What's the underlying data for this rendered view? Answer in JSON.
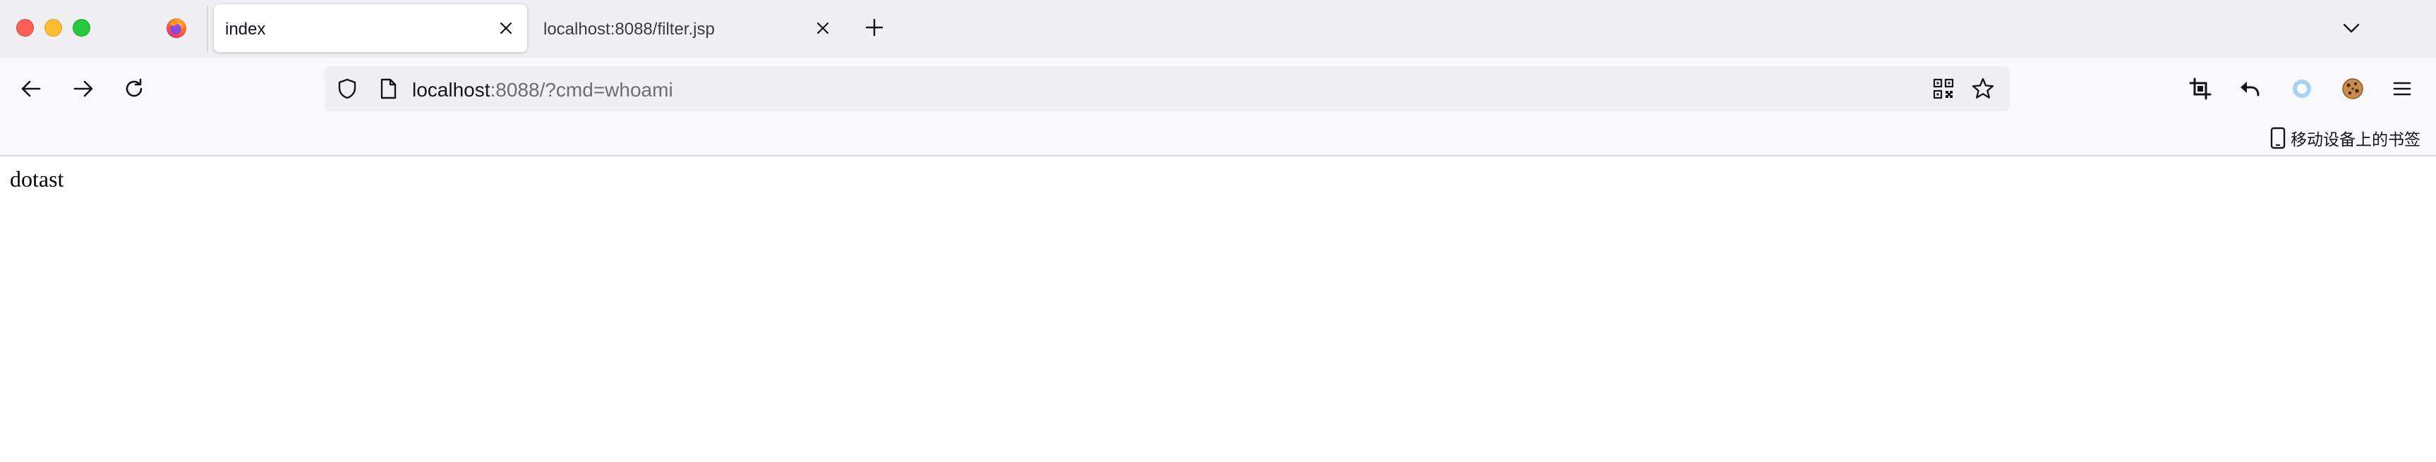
{
  "window": {
    "tabs": [
      {
        "label": "index",
        "active": true
      },
      {
        "label": "localhost:8088/filter.jsp",
        "active": false
      }
    ]
  },
  "urlbar": {
    "host": "localhost",
    "rest": ":8088/?cmd=whoami"
  },
  "bookmarks_bar": {
    "mobile_bookmarks_label": "移动设备上的书签"
  },
  "page": {
    "body_text": "dotast"
  },
  "icons": {
    "traffic_lights": [
      "close",
      "minimize",
      "maximize"
    ],
    "tab_strip": [
      "firefox-logo",
      "tab-close",
      "new-tab",
      "list-all-tabs"
    ],
    "nav": [
      "back",
      "forward",
      "reload",
      "shield",
      "page",
      "qr-code",
      "star",
      "crop",
      "undo",
      "ring",
      "cookie",
      "menu"
    ]
  },
  "colors": {
    "tabstrip_bg": "#f0f0f4",
    "toolbar_bg": "#f9f9fb",
    "urlbar_bg": "#f0f0f4",
    "traffic_close": "#fe5f57",
    "traffic_minimize": "#febc2e",
    "traffic_maximize": "#28c840"
  }
}
